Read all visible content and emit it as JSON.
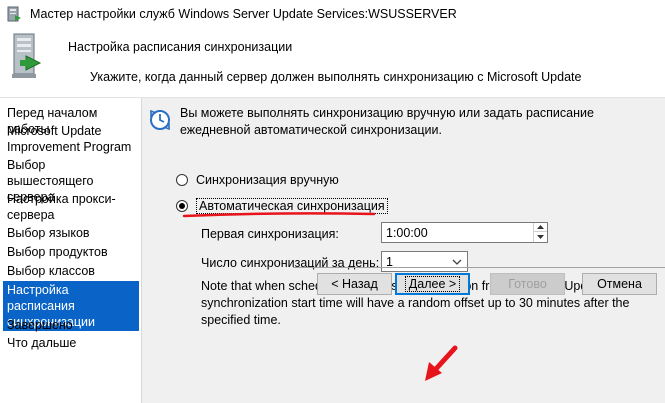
{
  "window": {
    "title": "Мастер настройки служб Windows Server Update Services:WSUSSERVER"
  },
  "header": {
    "title": "Настройка расписания синхронизации",
    "subtitle": "Укажите, когда данный сервер должен выполнять синхронизацию с Microsoft Update",
    "icon": "server-icon"
  },
  "sidebar": {
    "items": [
      {
        "label": "Перед началом работы",
        "active": false
      },
      {
        "label": "Microsoft Update Improvement Program",
        "active": false
      },
      {
        "label": "Выбор вышестоящего сервера",
        "active": false
      },
      {
        "label": "Настройка прокси-сервера",
        "active": false
      },
      {
        "label": "Выбор языков",
        "active": false
      },
      {
        "label": "Выбор продуктов",
        "active": false
      },
      {
        "label": "Выбор классов",
        "active": false
      },
      {
        "label": "Настройка расписания синхронизации",
        "active": true
      },
      {
        "label": "Завершено",
        "active": false
      },
      {
        "label": "Что дальше",
        "active": false
      }
    ]
  },
  "content": {
    "intro": "Вы можете выполнять синхронизацию вручную или задать расписание ежедневной автоматической синхронизации.",
    "options": {
      "manual": {
        "label": "Синхронизация вручную",
        "checked": false
      },
      "automatic": {
        "label": "Автоматическая синхронизация",
        "checked": true
      }
    },
    "first_sync_label": "Первая синхронизация:",
    "first_sync_value": "1:00:00",
    "syncs_per_day_label": "Число синхронизаций за день:",
    "syncs_per_day_value": "1",
    "note": "Note that when scheduling a daily synchronization from Microsoft Update, the synchronization start time will have a random offset up to 30 minutes after the specified time."
  },
  "buttons": {
    "back": "< Назад",
    "next": "Далее >",
    "finish": "Готово",
    "cancel": "Отмена"
  },
  "colors": {
    "accent": "#0a64c8",
    "annotation": "#e8141c",
    "content_bg": "#f0f0f0"
  }
}
